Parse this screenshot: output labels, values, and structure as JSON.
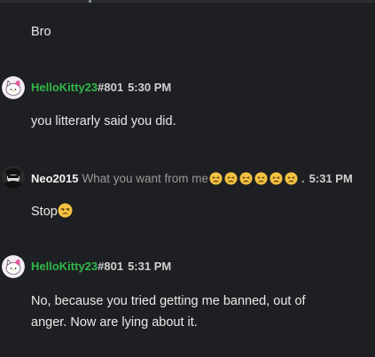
{
  "messages": [
    {
      "text": "Bro"
    },
    {
      "username": "HelloKitty23",
      "discriminator": "#801",
      "time": "5:30 PM",
      "text": "you litterarly said you did."
    },
    {
      "username": "Neo2015",
      "status": "What you want from me",
      "separator": ".",
      "time": "5:31 PM",
      "text": "Stop"
    },
    {
      "username": "HelloKitty23",
      "discriminator": "#801",
      "time": "5:31 PM",
      "text": "No, because you tried getting me banned, out of anger. Now are lying about it."
    }
  ],
  "colors": {
    "background": "#1e1f22",
    "username_green": "#2fb94a",
    "status_gray": "#9a9a9a"
  },
  "icons": {
    "status_emoji": "tired-face-emoji",
    "message_emoji": "unamused-face-emoji",
    "avatar_hellokitty": "hello-kitty-avatar",
    "avatar_neo": "neo-avatar"
  }
}
